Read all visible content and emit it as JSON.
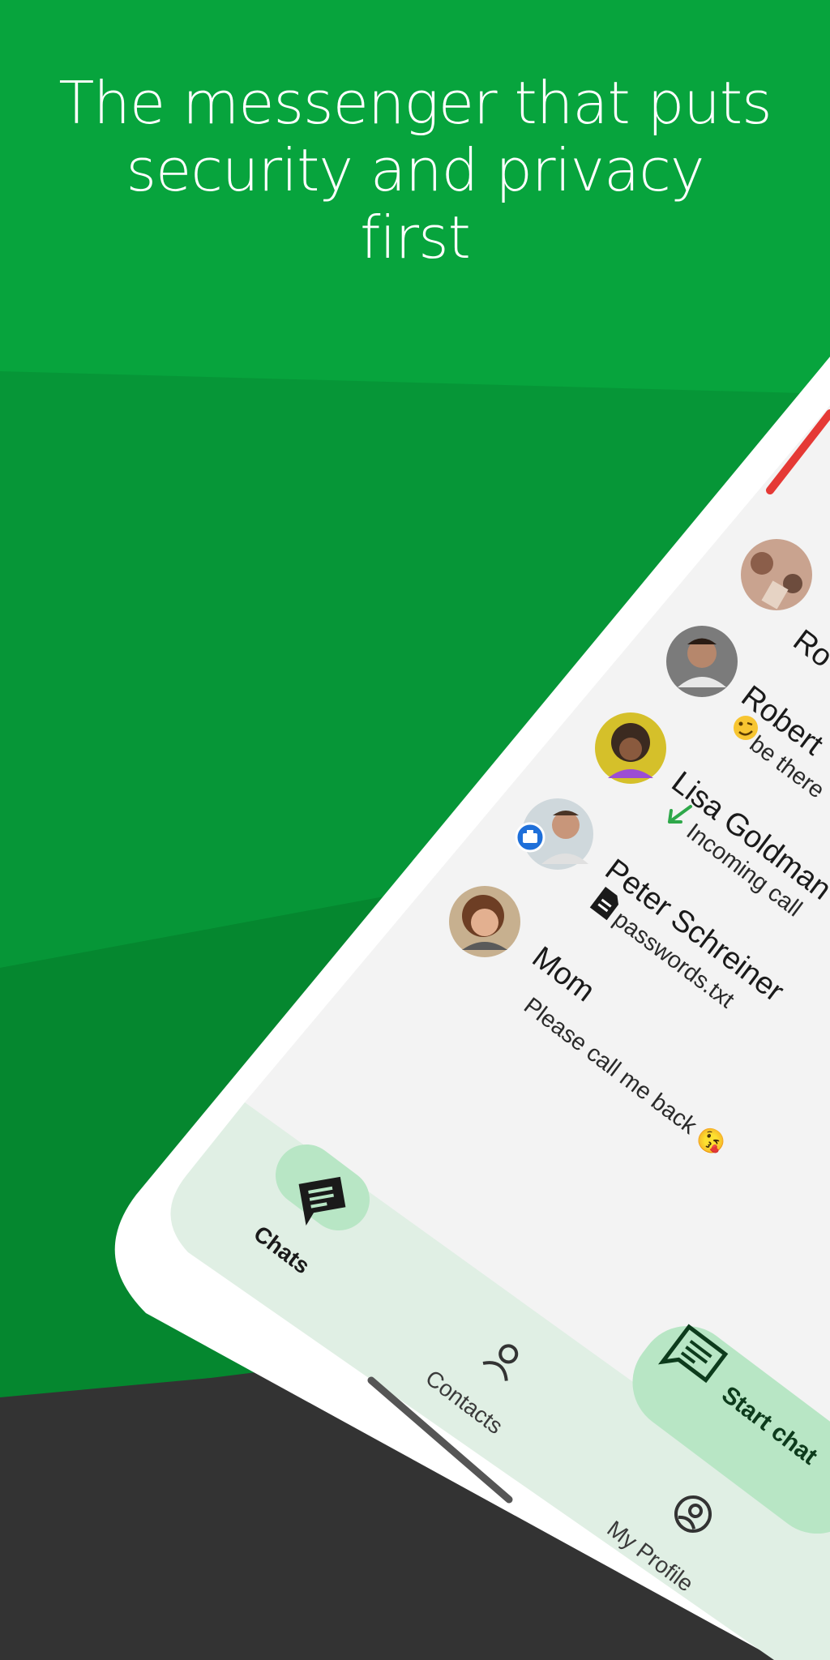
{
  "headline": [
    "The messenger that puts",
    "security and privacy",
    "first"
  ],
  "chats": [
    {
      "name": "Ro",
      "message": "",
      "avatar": "group-photo-avatar"
    },
    {
      "name": "Robert",
      "message": "be there",
      "status_icon": "winking-emoji-icon",
      "avatar": "man-avatar"
    },
    {
      "name": "Lisa Goldman",
      "message": "Incoming call",
      "status_icon": "incoming-call-arrow-icon",
      "avatar": "woman-avatar"
    },
    {
      "name": "Peter Schreiner",
      "message": "passwords.txt",
      "status_icon": "file-icon",
      "avatar": "man-work-avatar",
      "badge": "work-badge-icon"
    },
    {
      "name": "Mom",
      "message": "Please call me back 😘",
      "avatar": "older-woman-avatar"
    }
  ],
  "nav": {
    "chats": "Chats",
    "contacts": "Contacts",
    "profile": "My Profile"
  },
  "fab": {
    "label": "Start chat"
  },
  "colors": {
    "brand_green": "#07a43d",
    "dark_green": "#05872f",
    "nav_bg": "#e0efe4",
    "pill": "#b8e6c5",
    "charcoal": "#333333"
  }
}
